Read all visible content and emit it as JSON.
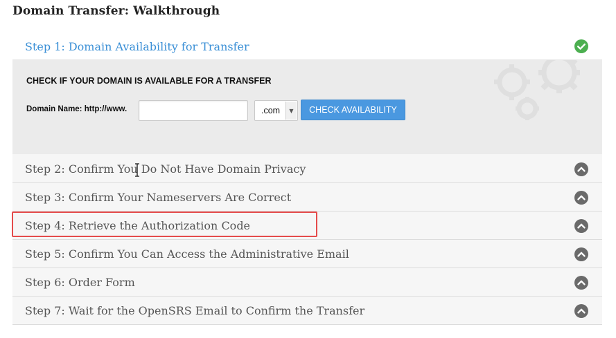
{
  "page": {
    "title": "Domain Transfer: Walkthrough"
  },
  "step1": {
    "label": "Step 1: Domain Availability for Transfer",
    "status_icon": "check-circle-icon",
    "heading": "CHECK IF YOUR DOMAIN IS AVAILABLE FOR A TRANSFER",
    "domain_label": "Domain Name: http://www.",
    "domain_value": "",
    "tld_selected": ".com",
    "button_label": "CHECK AVAILABILITY"
  },
  "steps": [
    {
      "label": "Step 2: Confirm You Do Not Have Domain Privacy",
      "icon": "chevron-up-icon"
    },
    {
      "label": "Step 3: Confirm Your Nameservers Are Correct",
      "icon": "chevron-up-icon"
    },
    {
      "label": "Step 4: Retrieve the Authorization Code",
      "icon": "chevron-up-icon"
    },
    {
      "label": "Step 5: Confirm You Can Access the Administrative Email",
      "icon": "chevron-up-icon"
    },
    {
      "label": "Step 6: Order Form",
      "icon": "chevron-up-icon"
    },
    {
      "label": "Step 7: Wait for the OpenSRS Email to Confirm the Transfer",
      "icon": "chevron-up-icon"
    }
  ],
  "colors": {
    "accent": "#3a8fd6",
    "button": "#4a98e0",
    "success": "#4caf50",
    "highlight": "#e54b4b"
  }
}
